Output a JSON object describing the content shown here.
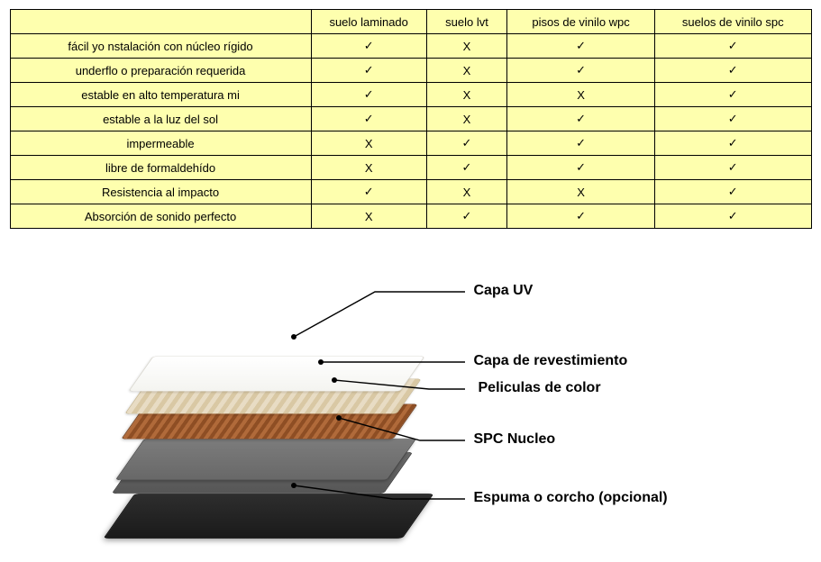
{
  "chart_data": {
    "type": "table",
    "columns": [
      "",
      "suelo laminado",
      "suelo lvt",
      "pisos de vinilo wpc",
      "suelos de vinilo spc"
    ],
    "rows": [
      {
        "label": "fácil yo nstalación con núcleo rígido",
        "values": [
          "✓",
          "X",
          "✓",
          "✓"
        ]
      },
      {
        "label": "underflo o preparación requerida",
        "values": [
          "✓",
          "X",
          "✓",
          "✓"
        ]
      },
      {
        "label": "estable en alto temperatura mi",
        "values": [
          "✓",
          "X",
          "X",
          "✓"
        ]
      },
      {
        "label": "estable a la luz del sol",
        "values": [
          "✓",
          "X",
          "✓",
          "✓"
        ]
      },
      {
        "label": "impermeable",
        "values": [
          "X",
          "✓",
          "✓",
          "✓"
        ]
      },
      {
        "label": "libre de formaldehído",
        "values": [
          "X",
          "✓",
          "✓",
          "✓"
        ]
      },
      {
        "label": "Resistencia al impacto",
        "values": [
          "✓",
          "X",
          "X",
          "✓"
        ]
      },
      {
        "label": "Absorción de sonido perfecto",
        "values": [
          "X",
          "✓",
          "✓",
          "✓"
        ]
      }
    ]
  },
  "diagram": {
    "layers": {
      "uv": "Capa UV",
      "wear": "Capa de revestimiento",
      "color": "Peliculas de color",
      "core": "SPC Nucleo",
      "foam": "Espuma o corcho (opcional)"
    }
  }
}
